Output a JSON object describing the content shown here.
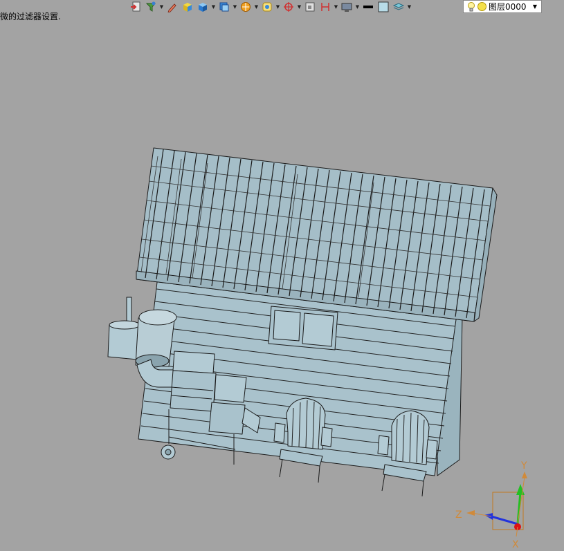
{
  "status_text": "微的过滤器设置.",
  "toolbar": {
    "buttons": [
      {
        "name": "exit-icon",
        "dropdown": false
      },
      {
        "name": "filter-icon",
        "dropdown": true
      },
      {
        "name": "pen-icon",
        "dropdown": false
      },
      {
        "name": "yellow-cube-icon",
        "dropdown": false
      },
      {
        "name": "blue-cube-icon",
        "dropdown": true
      },
      {
        "name": "view-cube-icon",
        "dropdown": true
      },
      {
        "name": "render-sphere-icon",
        "dropdown": true
      },
      {
        "name": "display-mode-icon",
        "dropdown": true
      },
      {
        "name": "snap-target-icon",
        "dropdown": true
      },
      {
        "name": "frame-icon",
        "dropdown": false
      },
      {
        "name": "ruler-icon",
        "dropdown": true
      },
      {
        "name": "monitor-icon",
        "dropdown": true
      },
      {
        "name": "line-color-icon",
        "dropdown": false
      },
      {
        "name": "fill-color-icon",
        "dropdown": false
      },
      {
        "name": "layer-stack-icon",
        "dropdown": true
      }
    ]
  },
  "layer_select": {
    "value": "图层0000"
  },
  "triad": {
    "y_label": "Y",
    "z_label": "Z",
    "x_label": "X"
  },
  "colors": {
    "background": "#a3a3a3",
    "model_fill": "#a9c2cc",
    "model_edge": "#1a1a1a",
    "axis_y": "#22c022",
    "axis_z": "#2233dd",
    "axis_x": "#dd1111",
    "axis_label": "#d08a3a"
  }
}
